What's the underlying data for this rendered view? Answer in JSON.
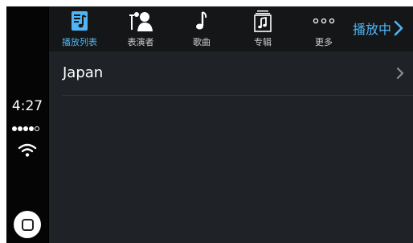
{
  "status": {
    "time": "4:27",
    "signal_bars_filled": 4,
    "signal_bars_total": 5
  },
  "tabs": [
    {
      "label": "播放列表",
      "icon": "playlist-icon",
      "active": true
    },
    {
      "label": "表演者",
      "icon": "artist-icon",
      "active": false
    },
    {
      "label": "歌曲",
      "icon": "music-note-icon",
      "active": false
    },
    {
      "label": "专辑",
      "icon": "album-icon",
      "active": false
    },
    {
      "label": "更多",
      "icon": "more-icon",
      "active": false
    }
  ],
  "now_playing": {
    "label": "播放中"
  },
  "list": {
    "items": [
      {
        "label": "Japan"
      }
    ]
  },
  "colors": {
    "accent": "#4fb5f5",
    "background": "#1f2226",
    "tabbar": "#141618"
  }
}
